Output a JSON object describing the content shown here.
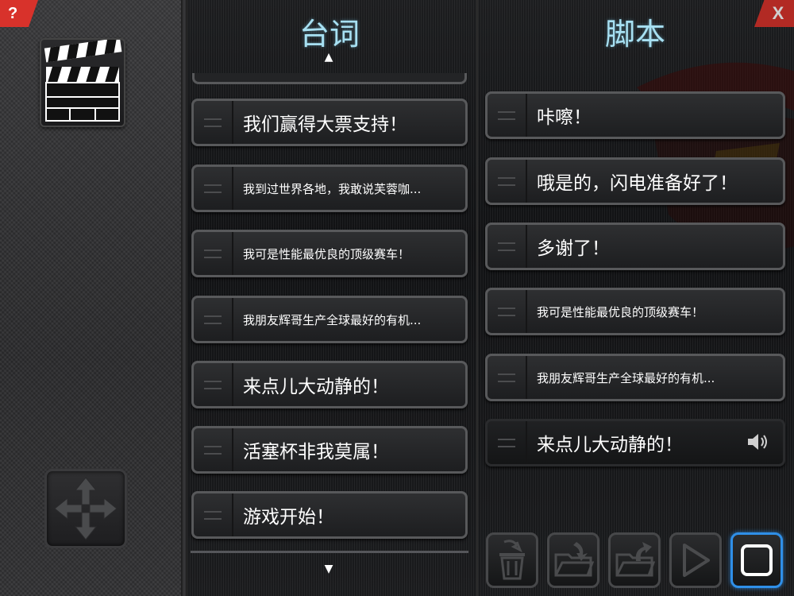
{
  "help_button": {
    "label": "?"
  },
  "close_button": {
    "label": "X"
  },
  "lines_panel": {
    "title": "台词",
    "items": [
      {
        "text": "我们赢得大票支持！",
        "size": "big"
      },
      {
        "text": "我到过世界各地，我敢说芙蓉咖...",
        "size": "small"
      },
      {
        "text": "我可是性能最优良的顶级赛车！",
        "size": "small"
      },
      {
        "text": "我朋友辉哥生产全球最好的有机...",
        "size": "small"
      },
      {
        "text": "来点儿大动静的！",
        "size": "big"
      },
      {
        "text": "活塞杯非我莫属！",
        "size": "big"
      },
      {
        "text": "游戏开始！",
        "size": "big"
      }
    ]
  },
  "script_panel": {
    "title": "脚本",
    "items": [
      {
        "text": "咔嚓！",
        "size": "big"
      },
      {
        "text": "哦是的，闪电准备好了！",
        "size": "big"
      },
      {
        "text": "多谢了！",
        "size": "big"
      },
      {
        "text": "我可是性能最优良的顶级赛车！",
        "size": "small"
      },
      {
        "text": "我朋友辉哥生产全球最好的有机...",
        "size": "small"
      },
      {
        "text": "来点儿大动静的！",
        "size": "big"
      }
    ]
  },
  "toolbar": {
    "buttons": [
      "delete",
      "load",
      "save",
      "play",
      "stop"
    ],
    "active": "stop"
  },
  "colors": {
    "accent": "#2f8fe8",
    "title": "#a7e0f2",
    "corner": "#d8322b"
  }
}
